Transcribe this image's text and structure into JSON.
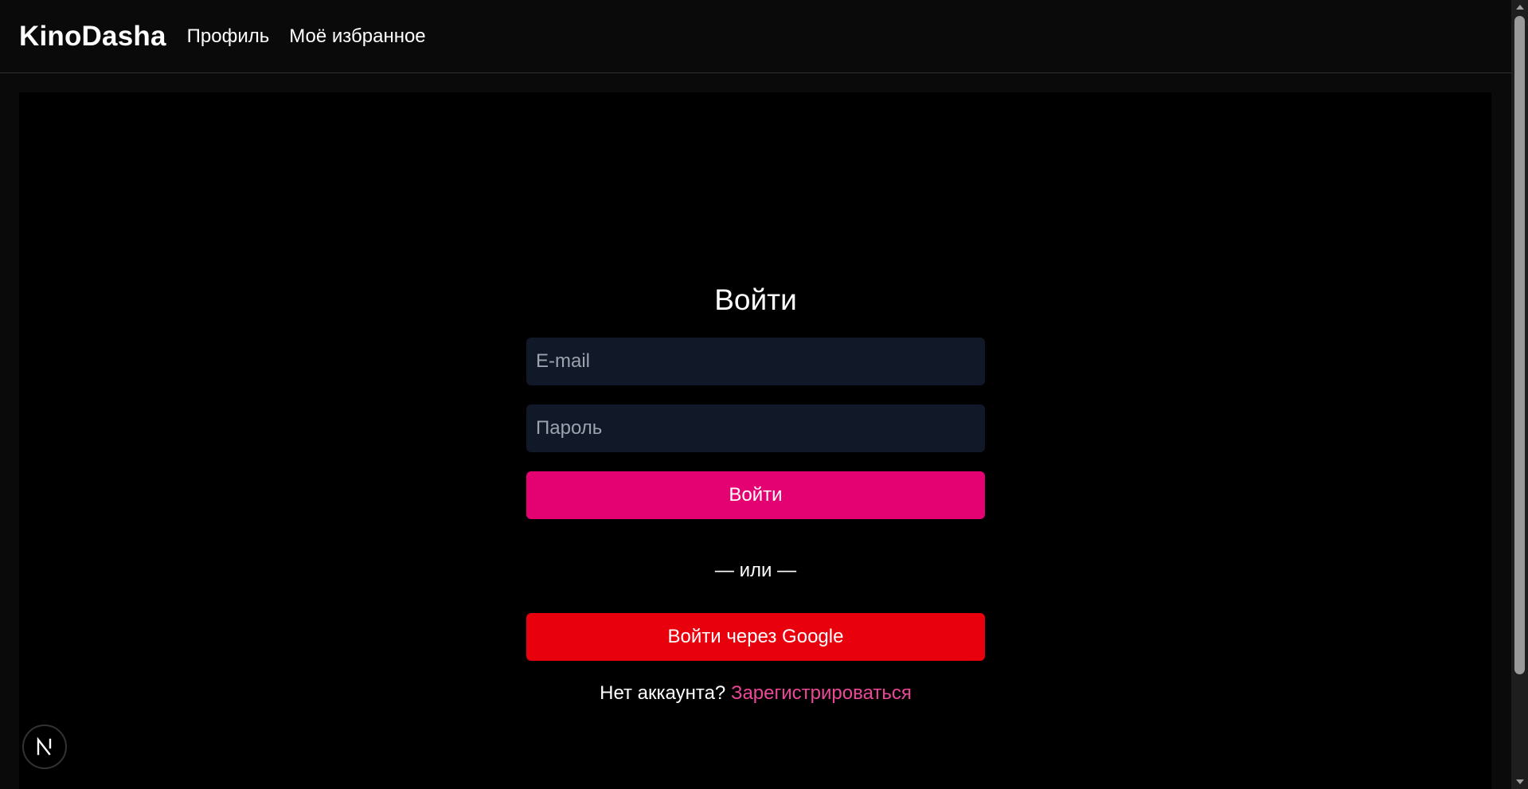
{
  "header": {
    "brand": "KinoDasha",
    "nav": [
      {
        "label": "Профиль"
      },
      {
        "label": "Моё избранное"
      }
    ]
  },
  "login_form": {
    "title": "Войти",
    "email_placeholder": "E-mail",
    "email_value": "",
    "password_placeholder": "Пароль",
    "password_value": "",
    "submit_label": "Войти",
    "divider": "— или —",
    "google_label": "Войти через Google",
    "no_account_text": "Нет аккаунта?",
    "register_label": "Зарегистрироваться"
  },
  "badge": {
    "icon": "nextjs-n-icon"
  },
  "colors": {
    "page_bg": "#0a0a0a",
    "panel_bg": "#000000",
    "input_bg": "#111827",
    "login_button": "#e40272",
    "google_button": "#e8000d",
    "register_link": "#ec4899"
  }
}
